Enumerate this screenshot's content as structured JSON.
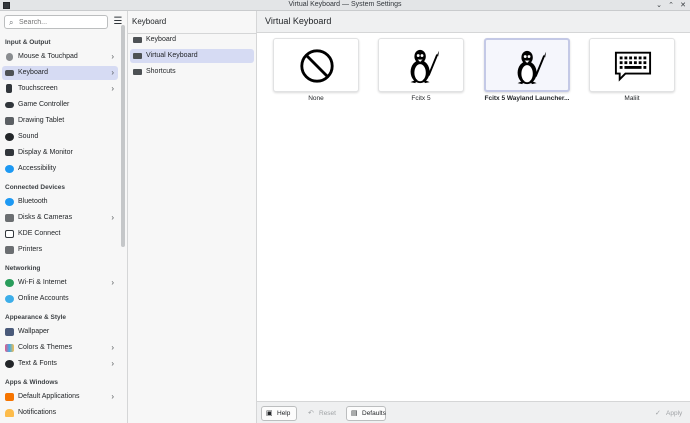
{
  "window": {
    "title": "Virtual Keyboard — System Settings",
    "controls": {
      "minimize": "⌄",
      "maximize": "⌃",
      "close": "✕"
    }
  },
  "sidebar": {
    "search_placeholder": "Search...",
    "categories": {
      "input_output": "Input & Output",
      "connected_devices": "Connected Devices",
      "networking": "Networking",
      "appearance_style": "Appearance & Style",
      "apps_windows": "Apps & Windows"
    },
    "items": [
      {
        "label": "Mouse & Touchpad",
        "icon": "mouse-icon",
        "color": "#8a8d90",
        "chevron": true
      },
      {
        "label": "Keyboard",
        "icon": "keyboard-icon",
        "color": "#4d5154",
        "chevron": true,
        "selected": true
      },
      {
        "label": "Touchscreen",
        "icon": "touchscreen-icon",
        "color": "#31363b",
        "chevron": true
      },
      {
        "label": "Game Controller",
        "icon": "gamepad-icon",
        "color": "#31363b",
        "chevron": false
      },
      {
        "label": "Drawing Tablet",
        "icon": "tablet-icon",
        "color": "#5b5f63",
        "chevron": false
      },
      {
        "label": "Sound",
        "icon": "sound-icon",
        "color": "#232629",
        "chevron": false
      },
      {
        "label": "Display & Monitor",
        "icon": "monitor-icon",
        "color": "#31363b",
        "chevron": false
      },
      {
        "label": "Accessibility",
        "icon": "accessibility-icon",
        "color": "#1d99f3",
        "chevron": false
      },
      {
        "label": "Bluetooth",
        "icon": "bluetooth-icon",
        "color": "#1d99f3",
        "chevron": false
      },
      {
        "label": "Disks & Cameras",
        "icon": "disk-icon",
        "color": "#6b6e71",
        "chevron": true
      },
      {
        "label": "KDE Connect",
        "icon": "kde-connect-icon",
        "color": "#31363b",
        "chevron": false
      },
      {
        "label": "Printers",
        "icon": "printer-icon",
        "color": "#6b6e71",
        "chevron": false
      },
      {
        "label": "Wi-Fi & Internet",
        "icon": "globe-icon",
        "color": "#2a9d5c",
        "chevron": true
      },
      {
        "label": "Online Accounts",
        "icon": "accounts-icon",
        "color": "#3daee9",
        "chevron": false
      },
      {
        "label": "Wallpaper",
        "icon": "wallpaper-icon",
        "color": "#4a5a7a",
        "chevron": false
      },
      {
        "label": "Colors & Themes",
        "icon": "palette-icon",
        "color": "#e8588a",
        "chevron": true
      },
      {
        "label": "Text & Fonts",
        "icon": "fonts-icon",
        "color": "#232629",
        "chevron": true
      },
      {
        "label": "Default Applications",
        "icon": "star-icon",
        "color": "#f67400",
        "chevron": true
      },
      {
        "label": "Notifications",
        "icon": "bell-icon",
        "color": "#fdbc4b",
        "chevron": false
      }
    ]
  },
  "middle": {
    "header": "Keyboard",
    "items": [
      {
        "label": "Keyboard"
      },
      {
        "label": "Virtual Keyboard",
        "selected": true
      },
      {
        "label": "Shortcuts"
      }
    ]
  },
  "main": {
    "title": "Virtual Keyboard",
    "tiles": [
      {
        "label": "None",
        "icon": "none-icon"
      },
      {
        "label": "Fcitx 5",
        "icon": "tux-icon"
      },
      {
        "label": "Fcitx 5 Wayland Launcher...",
        "icon": "tux-icon",
        "selected": true
      },
      {
        "label": "Maliit",
        "icon": "keyboard-chat-icon"
      }
    ]
  },
  "footer": {
    "help": "Help",
    "reset": "Reset",
    "defaults": "Defaults",
    "apply": "Apply"
  }
}
